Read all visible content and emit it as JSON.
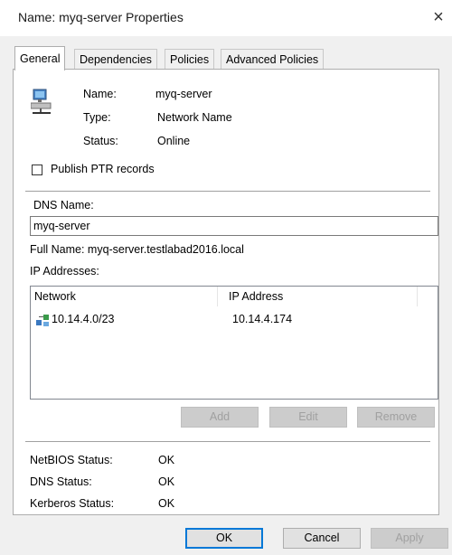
{
  "window": {
    "title": "Name: myq-server Properties",
    "close_glyph": "×"
  },
  "tabs": [
    {
      "label": "General",
      "active": true
    },
    {
      "label": "Dependencies",
      "active": false
    },
    {
      "label": "Policies",
      "active": false
    },
    {
      "label": "Advanced Policies",
      "active": false
    }
  ],
  "general": {
    "icon": "network-name-resource-icon",
    "fields": [
      {
        "label": "Name:",
        "value": "myq-server"
      },
      {
        "label": "Type:",
        "value": "Network Name"
      },
      {
        "label": "Status:",
        "value": "Online"
      }
    ],
    "publish_ptr": {
      "label": "Publish PTR records",
      "checked": false
    },
    "dns_name_label": "DNS Name:",
    "dns_name_value": "myq-server",
    "full_name": "Full Name: myq-server.testlabad2016.local",
    "ip_addresses_label": "IP Addresses:",
    "ip_table": {
      "columns": [
        "Network",
        "IP Address"
      ],
      "rows": [
        {
          "network": "10.14.4.0/23",
          "ip": "10.14.4.174",
          "icon": "network-icon"
        }
      ]
    },
    "list_buttons": {
      "add": "Add",
      "edit": "Edit",
      "remove": "Remove"
    },
    "statuses": [
      {
        "label": "NetBIOS Status:",
        "value": "OK"
      },
      {
        "label": "DNS Status:",
        "value": "OK"
      },
      {
        "label": "Kerberos Status:",
        "value": "OK"
      }
    ]
  },
  "footer": {
    "ok": "OK",
    "cancel": "Cancel",
    "apply": "Apply"
  },
  "colors": {
    "accent": "#0078d7",
    "dialog_bg": "#f0f0f0",
    "disabled_text": "#a0a0a0"
  }
}
